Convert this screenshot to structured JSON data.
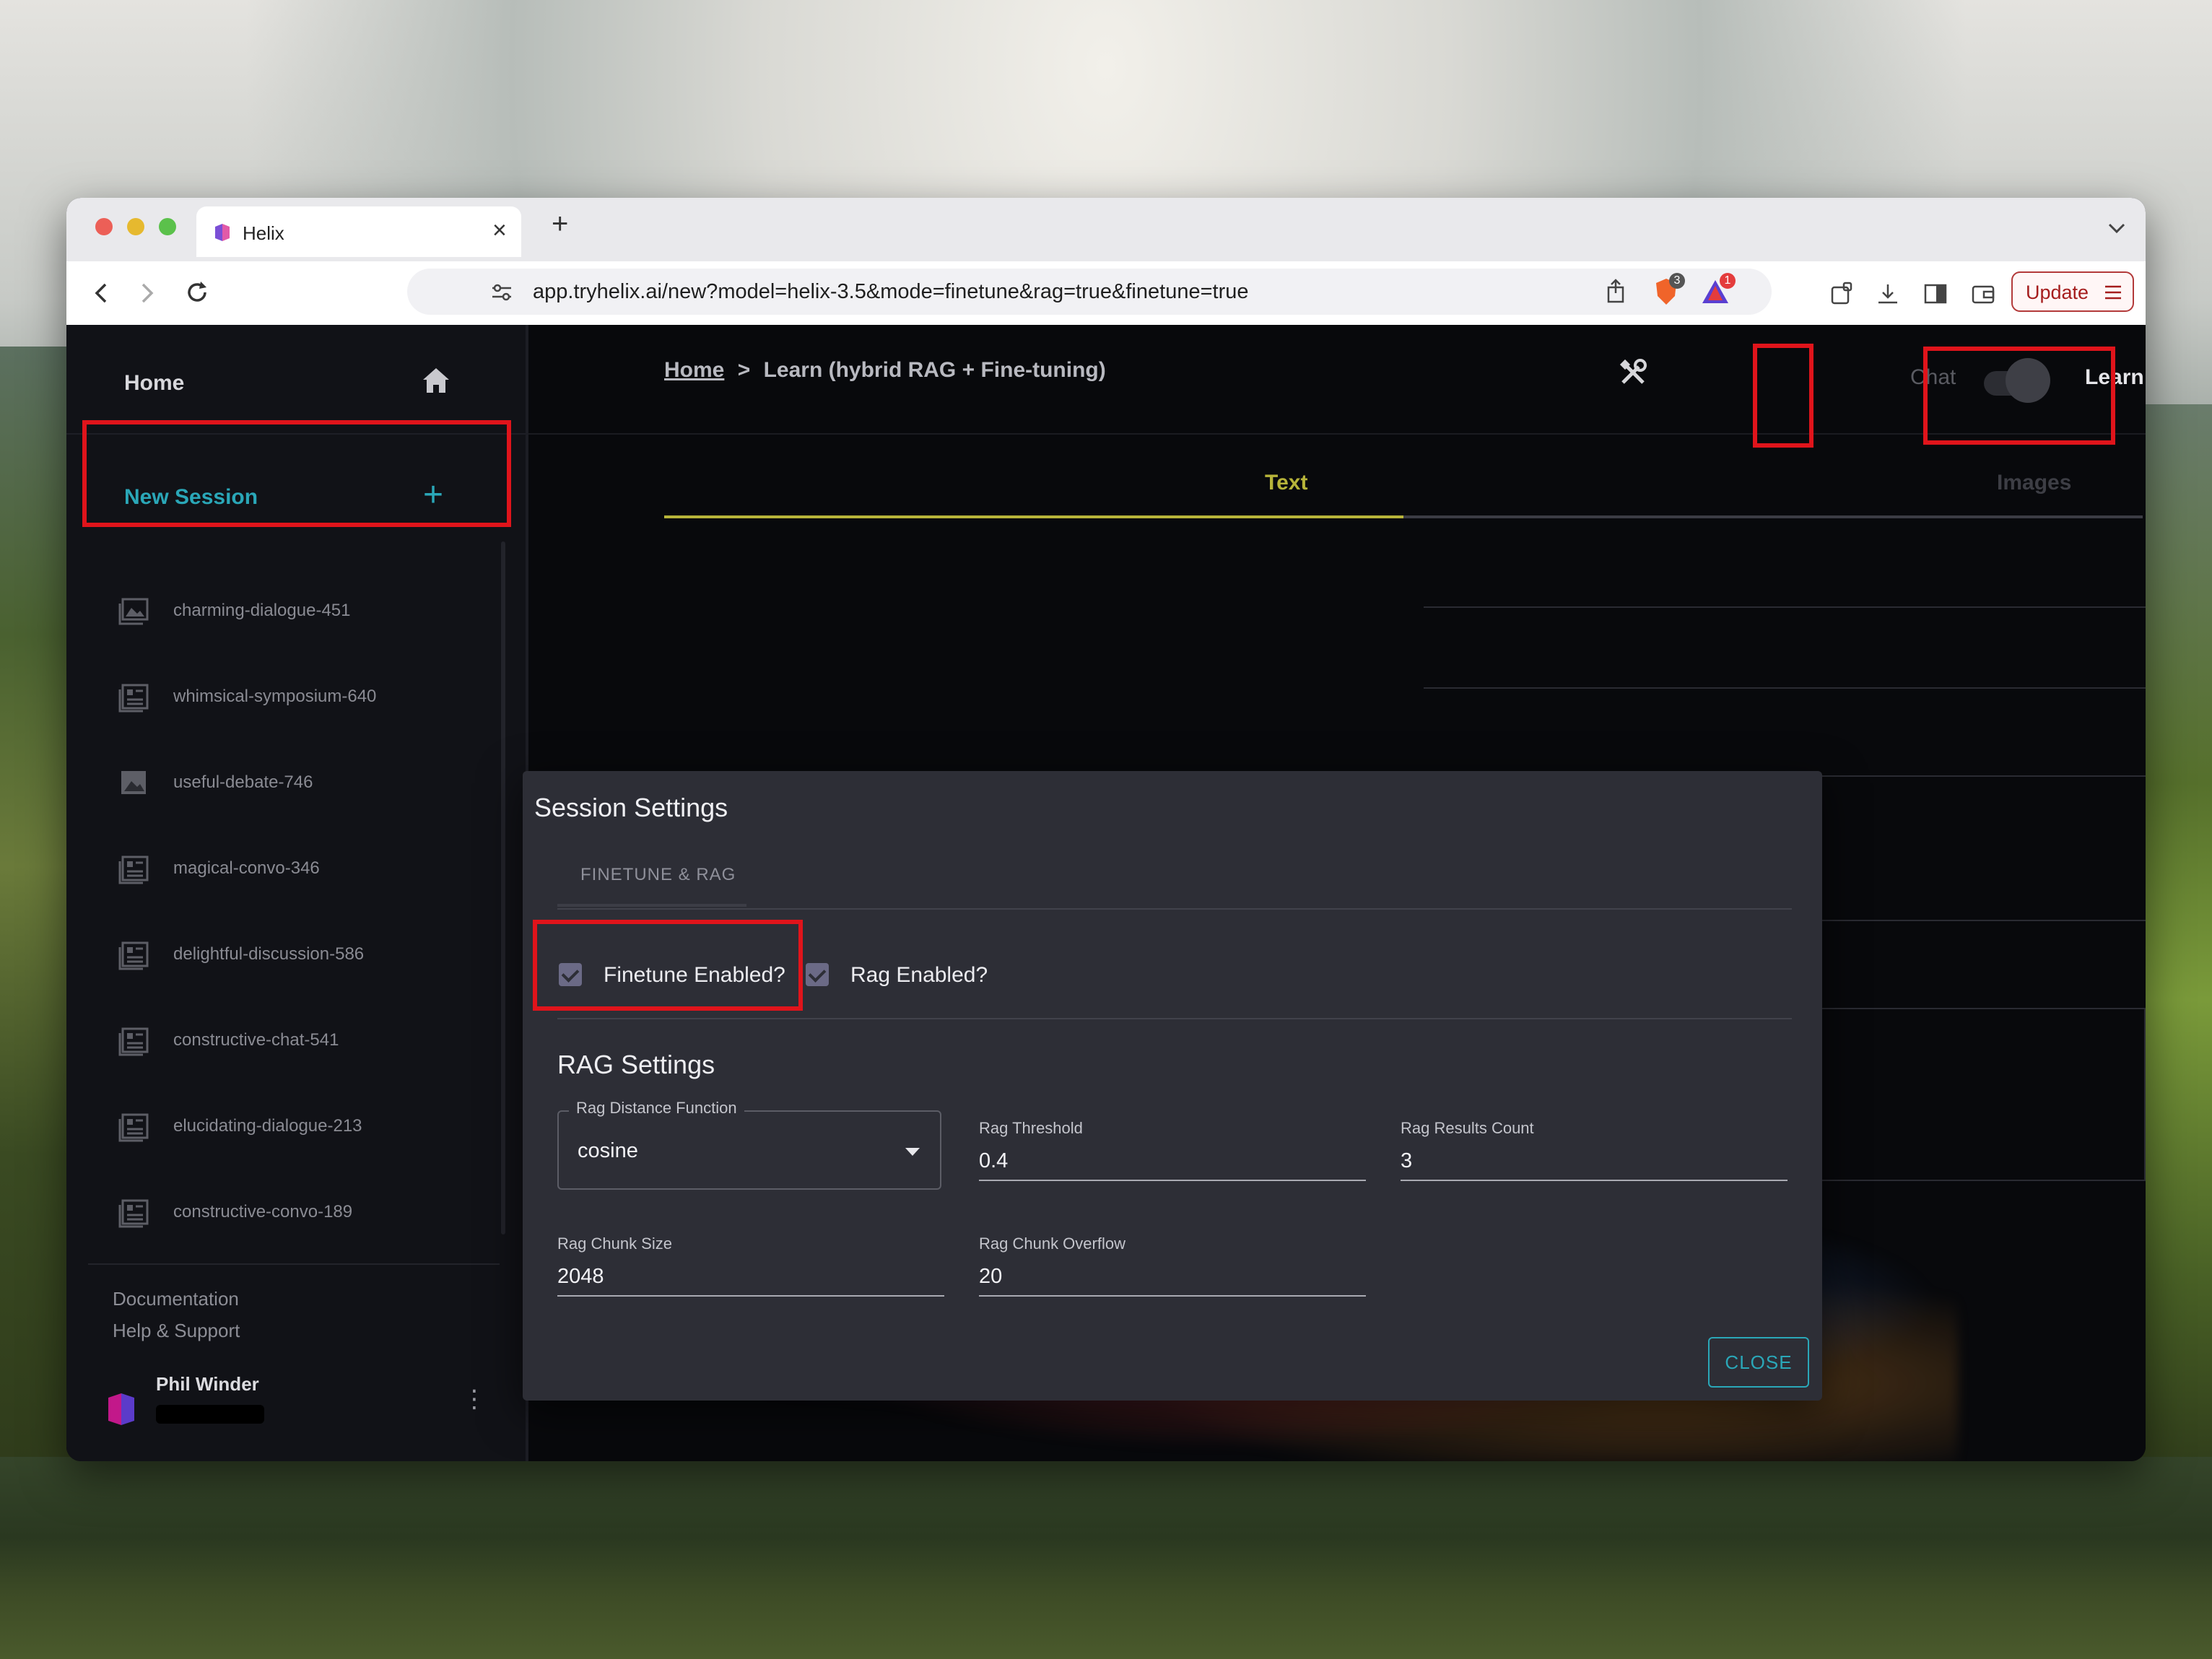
{
  "browser": {
    "tab_title": "Helix",
    "tab_close": "×",
    "new_tab": "+",
    "url": "app.tryhelix.ai/new?model=helix-3.5&mode=finetune&rag=true&finetune=true",
    "update_label": "Update",
    "brave_badge": "3",
    "alert_badge": "1"
  },
  "sidebar": {
    "home_label": "Home",
    "new_session_label": "New Session",
    "new_session_icon": "+",
    "sessions": [
      {
        "label": "charming-dialogue-451",
        "icon": "image-stack-icon"
      },
      {
        "label": "whimsical-symposium-640",
        "icon": "text-doc-icon"
      },
      {
        "label": "useful-debate-746",
        "icon": "image-icon"
      },
      {
        "label": "magical-convo-346",
        "icon": "text-doc-icon"
      },
      {
        "label": "delightful-discussion-586",
        "icon": "text-doc-icon"
      },
      {
        "label": "constructive-chat-541",
        "icon": "text-doc-icon"
      },
      {
        "label": "elucidating-dialogue-213",
        "icon": "text-doc-icon"
      },
      {
        "label": "constructive-convo-189",
        "icon": "text-doc-icon"
      }
    ],
    "documentation": "Documentation",
    "help_support": "Help & Support",
    "user_name": "Phil Winder",
    "menu_icon": "⋮"
  },
  "header": {
    "breadcrumb_home": "Home",
    "breadcrumb_sep": ">",
    "breadcrumb_current": "Learn (hybrid RAG + Fine-tuning)",
    "mode_chat": "Chat",
    "mode_learn": "Learn"
  },
  "main": {
    "tabs": [
      {
        "label": "Text"
      },
      {
        "label": "Images"
      }
    ]
  },
  "modal": {
    "title": "Session Settings",
    "tab": "FINETUNE & RAG",
    "finetune_label": "Finetune Enabled?",
    "rag_label": "Rag Enabled?",
    "rag_title": "RAG Settings",
    "distance_label": "Rag Distance Function",
    "distance_value": "cosine",
    "threshold_label": "Rag Threshold",
    "threshold_value": "0.4",
    "results_label": "Rag Results Count",
    "results_value": "3",
    "chunk_size_label": "Rag Chunk Size",
    "chunk_size_value": "2048",
    "chunk_overflow_label": "Rag Chunk Overflow",
    "chunk_overflow_value": "20",
    "close_label": "CLOSE"
  },
  "colors": {
    "accent": "#2aa7b8",
    "tab_active": "#b7b43a",
    "annotation": "#e0141b",
    "checkbox": "#6b6a86"
  }
}
